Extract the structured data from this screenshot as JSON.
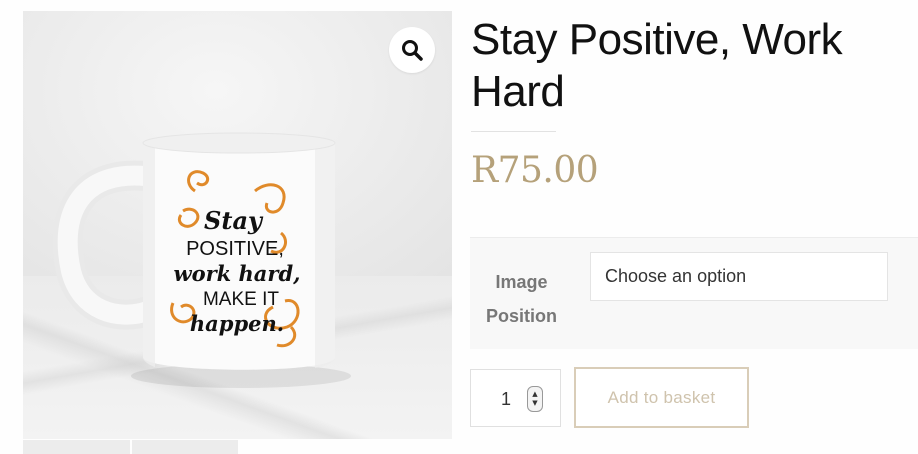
{
  "gallery": {
    "zoom_icon": "magnifier-icon",
    "mug_print": {
      "line1": "Stay",
      "line2": "POSITIVE,",
      "line3": "work hard,",
      "line4": "MAKE IT",
      "line5": "happen."
    }
  },
  "product": {
    "title": "Stay Positive, Work Hard",
    "price": "R75.00"
  },
  "variations": {
    "label": "Image Position",
    "select_value": "Choose an option"
  },
  "cart": {
    "quantity": "1",
    "add_label": "Add to basket"
  },
  "colors": {
    "price": "#b5a17a",
    "button_border": "#d9cdb8",
    "button_text": "#cfc3ad",
    "mug_accent": "#e08a2a"
  }
}
